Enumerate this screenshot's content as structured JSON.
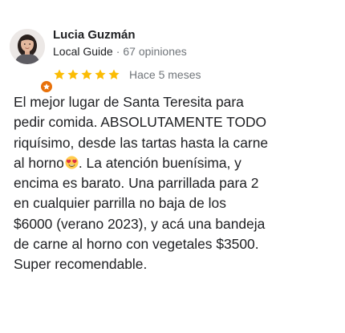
{
  "reviewer": {
    "name": "Lucia Guzmán",
    "level": "Local Guide",
    "separator": "·",
    "reviews_count": "67 opiniones",
    "avatar_icon": "user-avatar-photo",
    "badge_icon": "local-guide-star-badge"
  },
  "rating": {
    "stars": 5,
    "max": 5,
    "star_color": "#fbbc04",
    "date": "Hace 5 meses"
  },
  "review": {
    "lines": [
      "El mejor lugar de Santa Teresita para",
      "pedir comida. ABSOLUTAMENTE TODO",
      "riquísimo, desde las tartas hasta la carne",
      "al horno",
      ". La atención buenísima, y",
      "encima es barato. Una parrillada para 2",
      "en cualquier parrilla no baja de los",
      "$6000 (verano 2023), y acá una bandeja",
      "de carne al horno con vegetales $3500.",
      "Super recomendable."
    ],
    "emoji_icon": "smiling-face-with-heart-eyes-icon"
  },
  "colors": {
    "text_primary": "#202124",
    "text_secondary": "#70757a",
    "badge": "#e8710a"
  }
}
